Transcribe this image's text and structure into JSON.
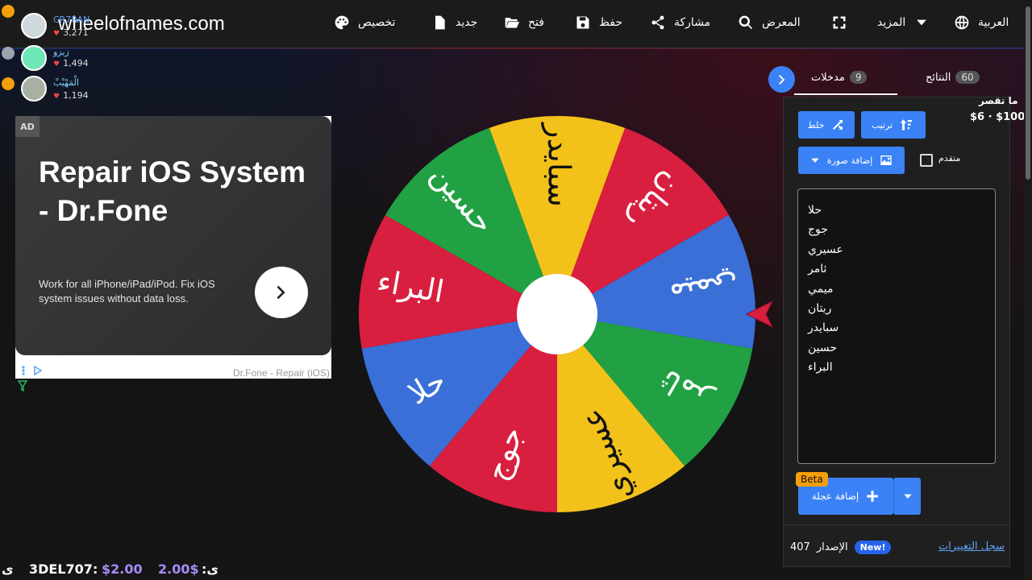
{
  "site": {
    "title": "wheelofnames.com"
  },
  "menu": {
    "customize": "تخصيص",
    "new": "جديد",
    "open": "فتح",
    "save": "حفظ",
    "share": "مشاركة",
    "gallery": "المعرض",
    "more": "المزيد",
    "language": "العربية"
  },
  "viewers": [
    {
      "name": "CR7RAN",
      "count": "3,271"
    },
    {
      "name": "زيزو",
      "count": "1,494"
    },
    {
      "name": "الْمَهْيْبْ",
      "count": "1,194"
    }
  ],
  "ad": {
    "badge": "AD",
    "headline": "Repair iOS System - Dr.Fone",
    "description": "Work for all iPhone/iPad/iPod. Fix iOS system issues without data loss.",
    "footer": "Dr.Fone - Repair (iOS)"
  },
  "wheel": {
    "segments": [
      {
        "label": "سبايدر",
        "color": "#f2c21a"
      },
      {
        "label": "ريتان",
        "color": "#d81f3f"
      },
      {
        "label": "ميمي",
        "color": "#3a6fd8"
      },
      {
        "label": "ثامر",
        "color": "#21a143"
      },
      {
        "label": "عسيري",
        "color": "#f2c21a"
      },
      {
        "label": "جوج",
        "color": "#d81f3f"
      },
      {
        "label": "حلا",
        "color": "#3a6fd8"
      },
      {
        "label": "البراء",
        "color": "#d81f3f"
      },
      {
        "label": "حسين",
        "color": "#21a143"
      }
    ]
  },
  "tabs": {
    "entries_label": "مدخلات",
    "entries_count": "9",
    "results_label": "النتائج",
    "results_count": "60"
  },
  "panel": {
    "shuffle": "خلط",
    "sort": "ترتيب",
    "add_image": "إضافة صورة",
    "advanced": "متقدم",
    "entries": [
      "حلا",
      "جوج",
      "عسيري",
      "ثامر",
      "ميمي",
      "ريتان",
      "سبايدر",
      "حسين",
      "البراء"
    ],
    "beta": "Beta",
    "add_wheel": "إضافة عجلة",
    "version_label": "الإصدار",
    "version_number": "407",
    "new_badge": "New!",
    "changelog": "سجل التغييرات"
  },
  "donation": {
    "label": "ما تقصر",
    "amount": "$6 · $100"
  },
  "ticker": {
    "item1_name": "3DEL707:",
    "item1_amount": "$2.00",
    "item2_amount": "2.00$",
    "item2_name": ":ى",
    "item3": "ى"
  }
}
